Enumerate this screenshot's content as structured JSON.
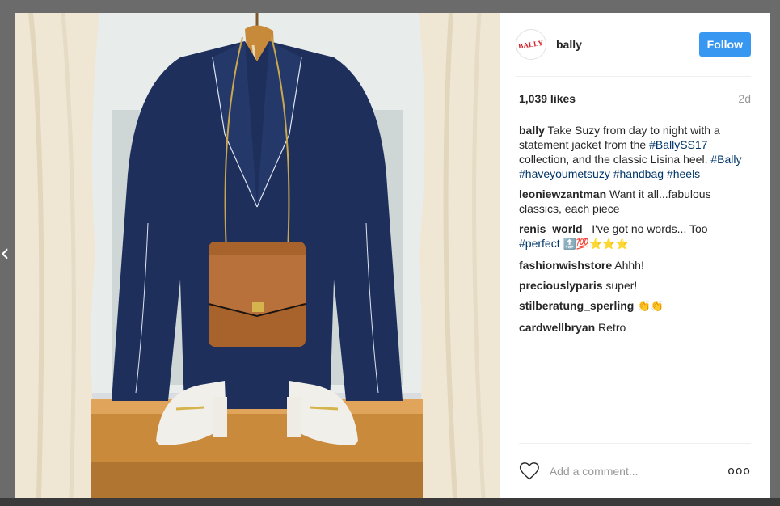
{
  "post": {
    "username": "bally",
    "avatar_text": "BALLY",
    "follow_label": "Follow",
    "likes": "1,039 likes",
    "time": "2d",
    "photo_alt": "Navy blazer with brown handbag and white heels hanging in a window"
  },
  "caption": {
    "user": "bally",
    "text_1": " Take Suzy from day to night with a statement jacket from the ",
    "tag_1": "#BallySS17",
    "text_2": " collection, and the classic Lisina heel. ",
    "tags": [
      "#Bally",
      "#haveyoumetsuzy",
      "#handbag",
      "#heels"
    ]
  },
  "comments": [
    {
      "user": "leoniewzantman",
      "text": " Want it all...fabulous classics, each piece"
    },
    {
      "user": "renis_world_",
      "text": " I've got no words... Too ",
      "tag": "#perfect",
      "emoji": " 🔝💯⭐⭐⭐"
    },
    {
      "user": "fashionwishstore",
      "text": " Ahhh!"
    },
    {
      "user": "preciouslyparis",
      "text": " super!"
    },
    {
      "user": "stilberatung_sperling",
      "text": " 👏👏"
    },
    {
      "user": "cardwellbryan",
      "text": " Retro"
    }
  ],
  "footer": {
    "comment_placeholder": "Add a comment...",
    "more_label": "ooo"
  },
  "nav": {
    "prev_label": "‹"
  },
  "colors": {
    "accent": "#3897f0",
    "hashtag": "#003569",
    "muted": "#999999",
    "text": "#262626",
    "backdrop": "#6b6b6b"
  }
}
